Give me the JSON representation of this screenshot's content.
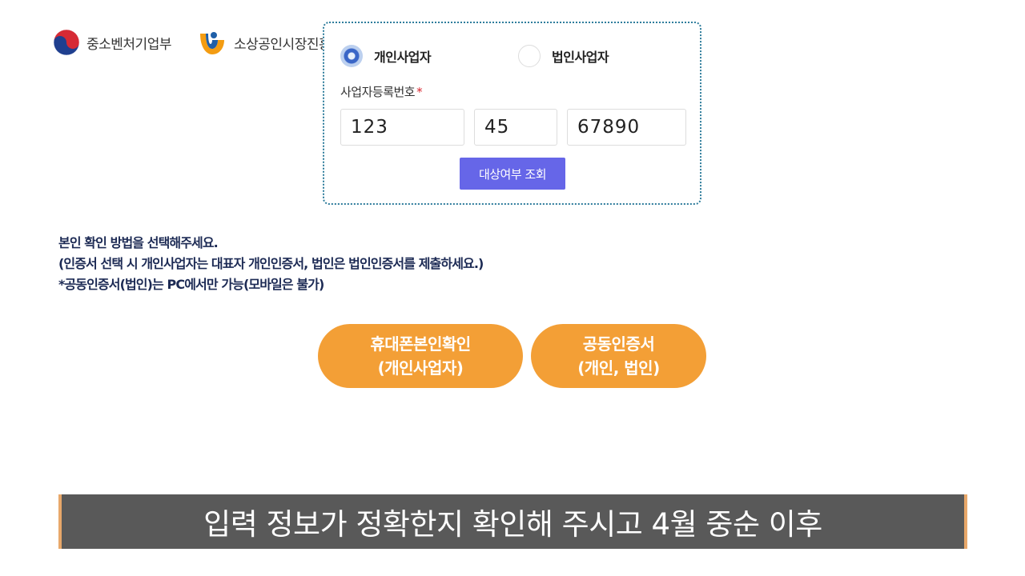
{
  "header": {
    "logo_mss": {
      "icon": "taegeuk-emblem-icon",
      "text": "중소벤처기업부"
    },
    "logo_semas": {
      "icon": "semas-emblem-icon",
      "text": "소상공인시장진흥공단"
    }
  },
  "form": {
    "radio_options": [
      {
        "label": "개인사업자",
        "checked": true
      },
      {
        "label": "법인사업자",
        "checked": false
      }
    ],
    "business_number_label": "사업자등록번호",
    "required_mark": "*",
    "business_number": [
      "123",
      "45",
      "67890"
    ],
    "check_button_label": "대상여부 조회"
  },
  "instructions": {
    "lines": [
      "본인 확인 방법을 선택해주세요.",
      "(인증서 선택 시 개인사업자는 대표자 개인인증서, 법인은 법인인증서를 제출하세요.)",
      "*공동인증서(법인)는 PC에서만 가능(모바일은 불가)"
    ]
  },
  "auth_buttons": {
    "phone": {
      "line1": "휴대폰본인확인",
      "line2": "(개인사업자)"
    },
    "cert": {
      "line1": "공동인증서",
      "line2": "(개인, 법인)"
    }
  },
  "subtitle": "입력 정보가 정확한지 확인해 주시고 4월 중순 이후",
  "colors": {
    "card_border": "#2f7d9c",
    "check_button": "#6666e8",
    "auth_button": "#f39f36",
    "radio_checked": "#3a66c7",
    "required": "#d9262f",
    "instruction_text": "#1c2a54",
    "subtitle_bg": "#595959",
    "subtitle_accent": "#e8a86a"
  }
}
